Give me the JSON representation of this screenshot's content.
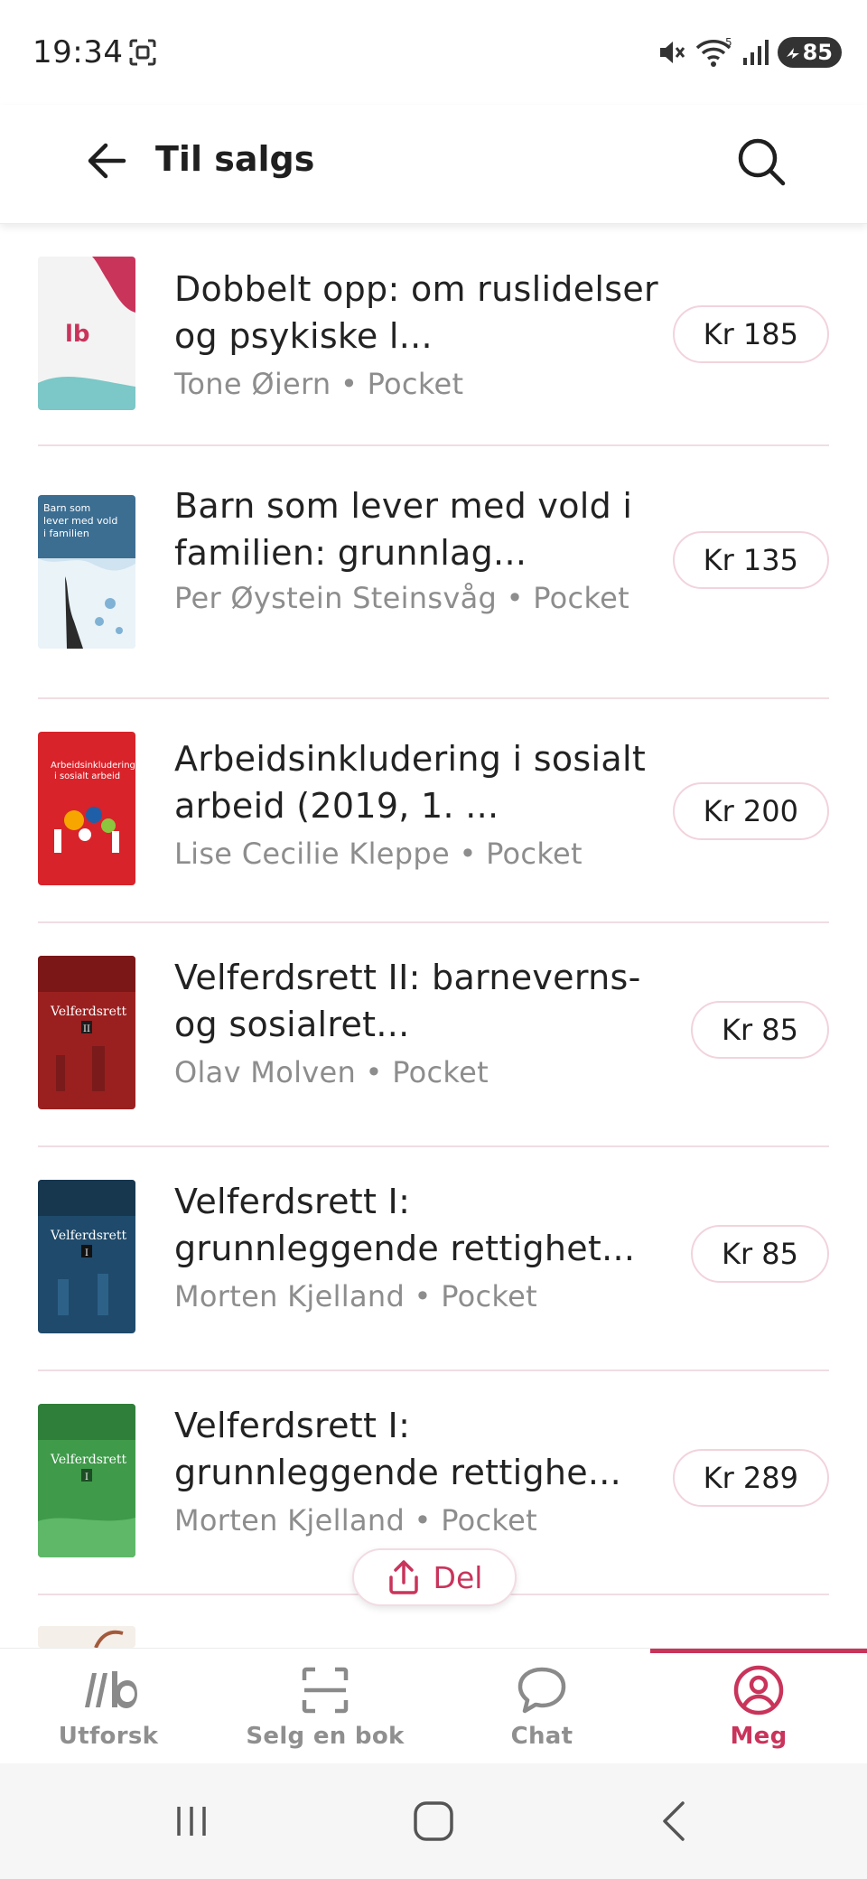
{
  "status_bar": {
    "time": "19:34",
    "battery": "85",
    "icons": [
      "screenshot-icon",
      "mute-icon",
      "wifi-icon",
      "signal-icon",
      "battery-icon"
    ]
  },
  "header": {
    "title": "Til salgs",
    "back_icon": "arrow-left-icon",
    "search_icon": "search-icon"
  },
  "listings": [
    {
      "title": "Dobbelt opp: om ruslidelser og psykiske l...",
      "meta": "Tone Øiern • Pocket",
      "price": "Kr 185",
      "cover_text": "lb"
    },
    {
      "title": "Barn som lever med vold i familien: grunnlag...",
      "meta": "Per Øystein Steinsvåg • Pocket",
      "price": "Kr 135",
      "cover_text": "Barn som lever med vold i familien"
    },
    {
      "title": "Arbeidsinkludering i sosialt arbeid (2019, 1. ...",
      "meta": "Lise Cecilie Kleppe • Pocket",
      "price": "Kr 200",
      "cover_text": "Arbeidsinkludering i sosialt arbeid"
    },
    {
      "title": "Velferdsrett II: barneverns- og sosialret...",
      "meta": "Olav Molven • Pocket",
      "price": "Kr 85",
      "cover_text": "Velferdsrett"
    },
    {
      "title": "Velferdsrett I: grunnleggende rettighet...",
      "meta": "Morten Kjelland • Pocket",
      "price": "Kr 85",
      "cover_text": "Velferdsrett"
    },
    {
      "title": "Velferdsrett I: grunnleggende rettighe...",
      "meta": "Morten Kjelland • Pocket",
      "price": "Kr 289",
      "cover_text": "Velferdsrett"
    }
  ],
  "share": {
    "label": "Del",
    "icon": "share-icon"
  },
  "bottom_nav": [
    {
      "label": "Utforsk",
      "icon": "lb-logo-icon",
      "active": false
    },
    {
      "label": "Selg en bok",
      "icon": "scan-icon",
      "active": false
    },
    {
      "label": "Chat",
      "icon": "chat-bubble-icon",
      "active": false
    },
    {
      "label": "Meg",
      "icon": "profile-icon",
      "active": true
    }
  ],
  "colors": {
    "accent": "#c9345b",
    "price_border": "#f2d3dc",
    "divider": "#f1dde3",
    "muted_text": "#8d8d8d"
  }
}
